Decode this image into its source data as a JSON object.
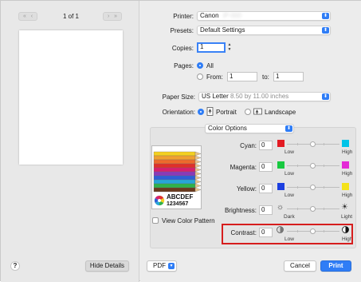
{
  "preview": {
    "page_counter": "1 of 1",
    "nav_first": "«",
    "nav_prev": "‹",
    "nav_next": "›",
    "nav_last": "»"
  },
  "footer": {
    "help": "?",
    "hide_details": "Hide Details",
    "pdf": "PDF",
    "cancel": "Cancel",
    "print": "Print"
  },
  "printer": {
    "label": "Printer:",
    "value": "Canon",
    "redacted": "iP-000"
  },
  "presets": {
    "label": "Presets:",
    "value": "Default Settings"
  },
  "copies": {
    "label": "Copies:",
    "value": "1"
  },
  "pages": {
    "label": "Pages:",
    "all": "All",
    "from_label": "From:",
    "from_value": "1",
    "to_label": "to:",
    "to_value": "1"
  },
  "paper_size": {
    "label": "Paper Size:",
    "value": "US Letter",
    "detail": "8.50 by 11.00 inches"
  },
  "orientation": {
    "label": "Orientation:",
    "portrait": "Portrait",
    "landscape": "Landscape"
  },
  "color_options": {
    "value": "Color Options"
  },
  "sample": {
    "line1": "ABCDEF",
    "line2": "1234567"
  },
  "view_color_pattern": "View Color Pattern",
  "sliders": [
    {
      "label": "Cyan:",
      "value": "0",
      "left": "Low",
      "right": "High",
      "left_color": "#e31b23",
      "right_color": "#00c4e8"
    },
    {
      "label": "Magenta:",
      "value": "0",
      "left": "Low",
      "right": "High",
      "left_color": "#18c940",
      "right_color": "#e42ad6"
    },
    {
      "label": "Yellow:",
      "value": "0",
      "left": "Low",
      "right": "High",
      "left_color": "#1c3fe0",
      "right_color": "#f4e21b"
    },
    {
      "label": "Brightness:",
      "value": "0",
      "left": "Dark",
      "right": "Light"
    },
    {
      "label": "Contrast:",
      "value": "0",
      "left": "Low",
      "right": "High"
    }
  ]
}
